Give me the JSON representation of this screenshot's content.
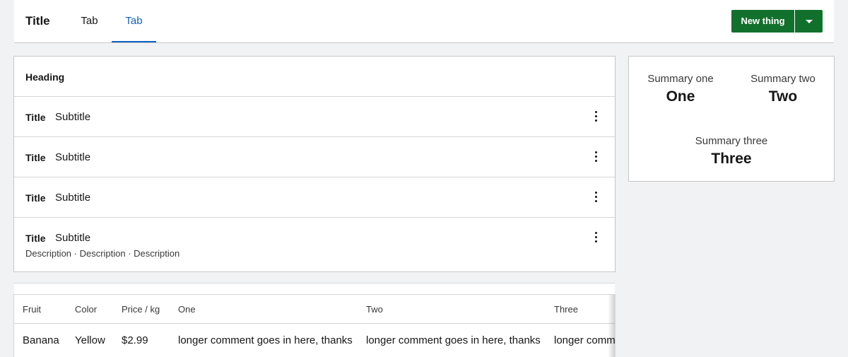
{
  "header": {
    "title": "Title",
    "tabs": [
      {
        "label": "Tab",
        "active": false
      },
      {
        "label": "Tab",
        "active": true
      }
    ],
    "primary_button": "New thing",
    "accent_color": "#12702d",
    "active_tab_color": "#0f62c4"
  },
  "list_card": {
    "heading": "Heading",
    "rows": [
      {
        "title": "Title",
        "subtitle": "Subtitle"
      },
      {
        "title": "Title",
        "subtitle": "Subtitle"
      },
      {
        "title": "Title",
        "subtitle": "Subtitle"
      },
      {
        "title": "Title",
        "subtitle": "Subtitle",
        "description": "Description · Description · Description"
      }
    ],
    "row_menu_icon": "kebab-menu-icon"
  },
  "table": {
    "columns": [
      "Fruit",
      "Color",
      "Price / kg",
      "One",
      "Two",
      "Three"
    ],
    "rows": [
      [
        "Banana",
        "Yellow",
        "$2.99",
        "longer comment goes in here, thanks",
        "longer comment goes in here, thanks",
        "longer comm"
      ]
    ]
  },
  "summary": {
    "items": [
      {
        "label": "Summary one",
        "value": "One"
      },
      {
        "label": "Summary two",
        "value": "Two"
      },
      {
        "label": "Summary three",
        "value": "Three"
      }
    ]
  }
}
